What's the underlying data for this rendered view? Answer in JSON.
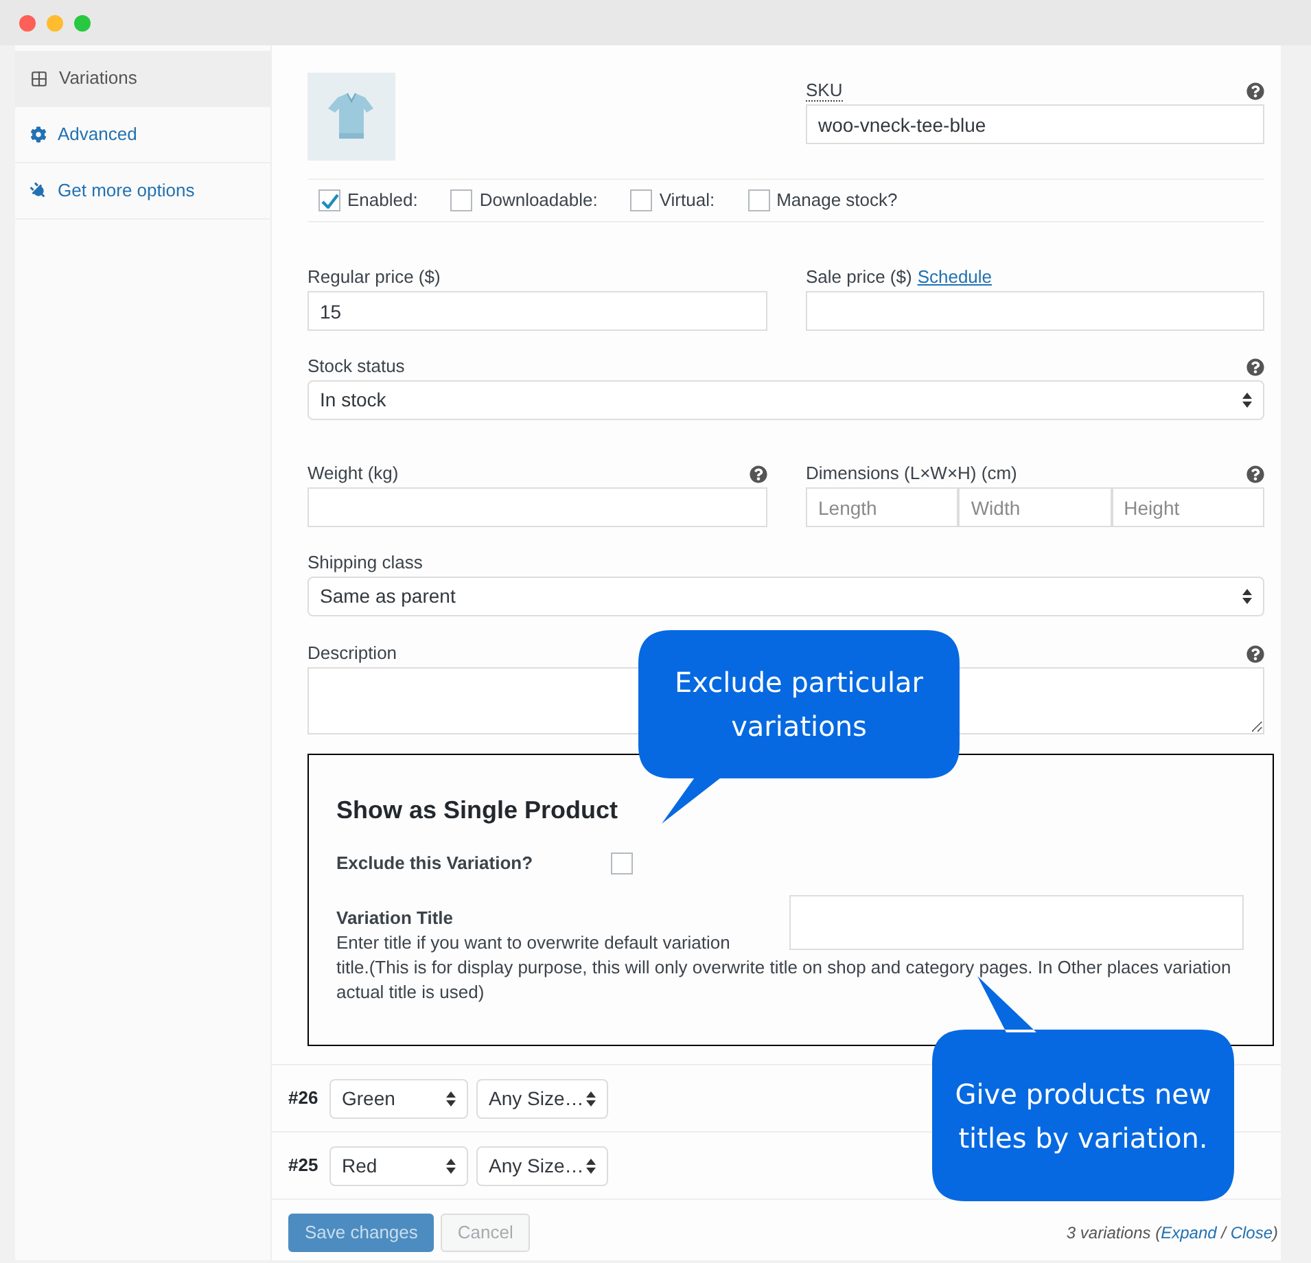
{
  "sidebar": {
    "items": [
      {
        "label": "Variations",
        "selected": true
      },
      {
        "label": "Advanced",
        "selected": false
      },
      {
        "label": "Get more options",
        "selected": false
      }
    ]
  },
  "variation": {
    "sku": {
      "label": "SKU",
      "value": "woo-vneck-tee-blue",
      "help": true
    },
    "options": [
      {
        "label": "Enabled:",
        "checked": true
      },
      {
        "label": "Downloadable:",
        "checked": false
      },
      {
        "label": "Virtual:",
        "checked": false
      },
      {
        "label": "Manage stock?",
        "checked": false
      }
    ],
    "regular_price": {
      "label": "Regular price ($)",
      "value": "15"
    },
    "sale_price": {
      "label": "Sale price ($)",
      "link": "Schedule"
    },
    "stock_status": {
      "label": "Stock status",
      "value": "In stock",
      "help": true
    },
    "weight": {
      "label": "Weight (kg)",
      "help": true
    },
    "dimensions": {
      "label": "Dimensions (L×W×H) (cm)",
      "help": true,
      "placeholders": [
        "Length",
        "Width",
        "Height"
      ]
    },
    "shipping_class": {
      "label": "Shipping class",
      "value": "Same as parent"
    },
    "description": {
      "label": "Description",
      "help": true
    },
    "single_product": {
      "title": "Show as Single Product",
      "exclude": {
        "label": "Exclude this Variation?",
        "checked": false
      },
      "variation_title": {
        "label": "Variation Title",
        "hint": "Enter title if you want to overwrite default variation title.(This is for display purpose, this will only overwrite title on shop and category pages. In Other places variation actual title is used)"
      }
    }
  },
  "other_variations": [
    {
      "number": "#26",
      "attributes": [
        "Green",
        "Any Size…"
      ]
    },
    {
      "number": "#25",
      "attributes": [
        "Red",
        "Any Size…"
      ]
    }
  ],
  "buttons": [
    {
      "label": "Save changes",
      "kind": "primary",
      "disabled": true
    },
    {
      "label": "Cancel",
      "kind": "secondary",
      "disabled": true
    }
  ],
  "footer": {
    "prefix": "3 variations (",
    "links": [
      "Expand",
      "Close"
    ],
    "separator": " / ",
    "suffix": ")"
  },
  "callouts": [
    {
      "text": "Exclude particular variations"
    },
    {
      "text": "Give products new titles by variation."
    }
  ]
}
